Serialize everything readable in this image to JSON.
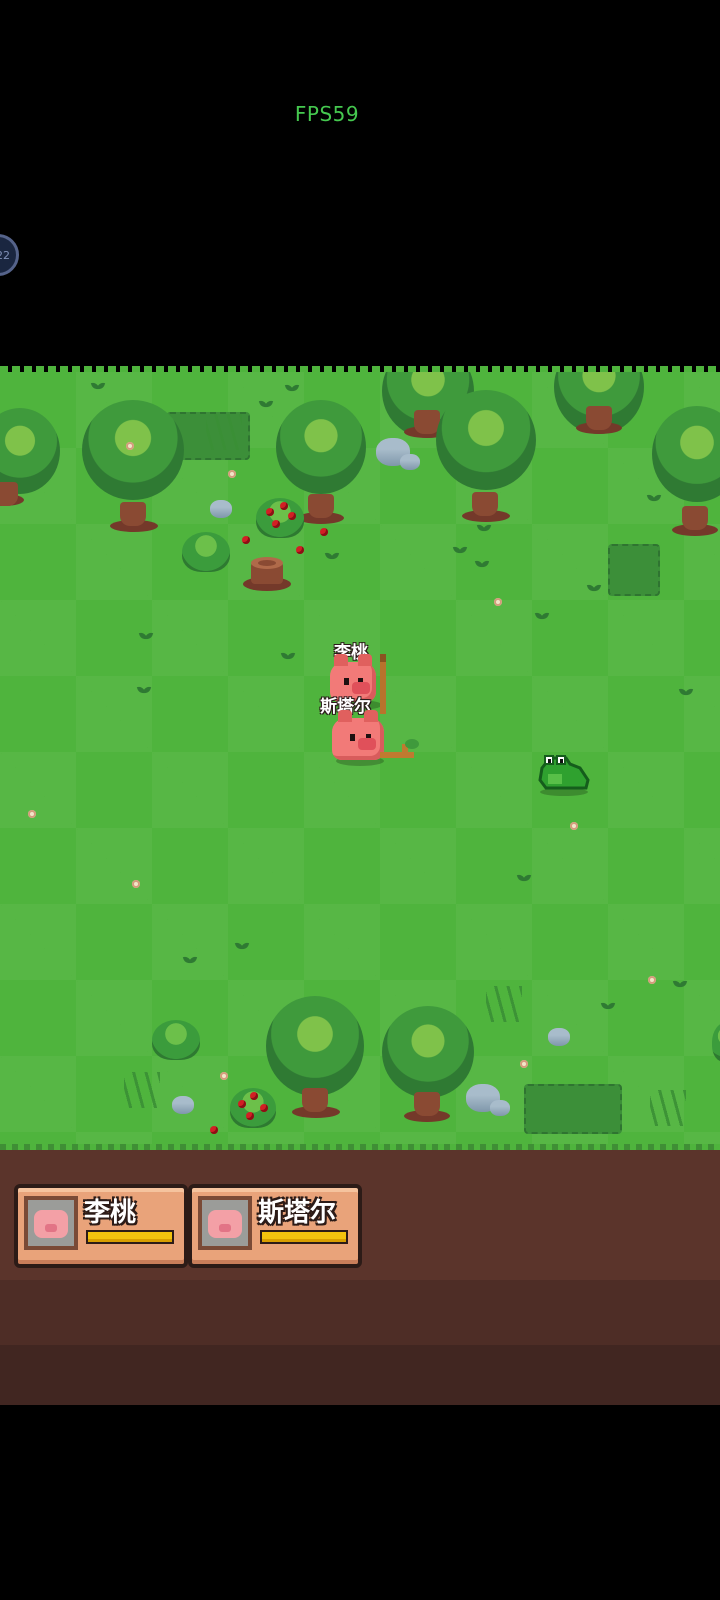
{
  "hud": {
    "fps": "FPS59",
    "float_button_label": "22"
  },
  "characters": [
    {
      "name": "李桃"
    },
    {
      "name": "斯塔尔"
    }
  ],
  "party": [
    {
      "name": "李桃",
      "hp": 1.0
    },
    {
      "name": "斯塔尔",
      "hp": 1.0
    }
  ],
  "colors": {
    "grass": "#4fb43d",
    "dirt": "#5b342b",
    "hp": "#f2c20e",
    "card": "#e9a37a"
  }
}
